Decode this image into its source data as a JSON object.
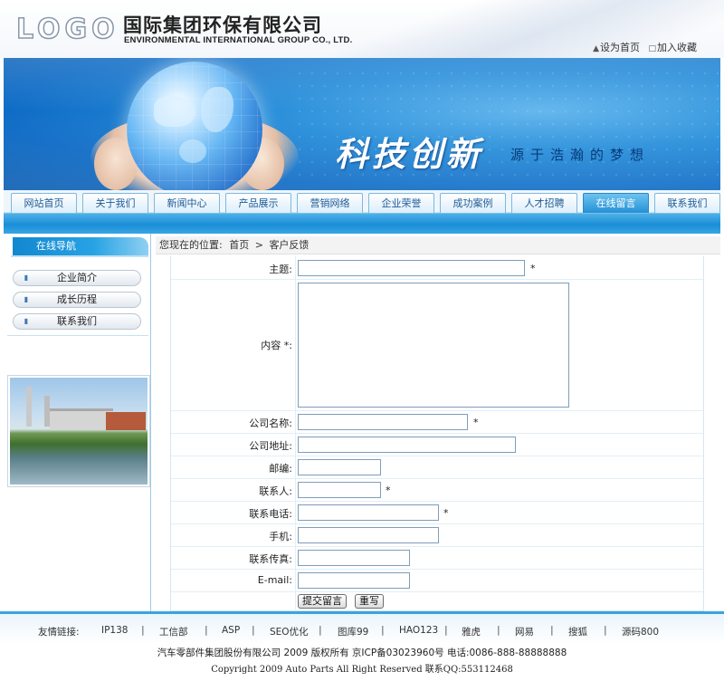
{
  "header": {
    "logo_text": "LOGO",
    "company_cn": "国际集团环保有限公司",
    "company_en": "ENVIRONMENTAL INTERNATIONAL GROUP CO., LTD.",
    "set_home_label": "设为首页",
    "add_favorite_label": "加入收藏"
  },
  "banner": {
    "slogan_main": "科技创新",
    "slogan_sub": "源于浩瀚的梦想"
  },
  "nav": {
    "items": [
      {
        "label": "网站首页"
      },
      {
        "label": "关于我们"
      },
      {
        "label": "新闻中心"
      },
      {
        "label": "产品展示"
      },
      {
        "label": "营销网络"
      },
      {
        "label": "企业荣誉"
      },
      {
        "label": "成功案例"
      },
      {
        "label": "人才招聘"
      },
      {
        "label": "在线留言"
      },
      {
        "label": "联系我们"
      }
    ],
    "active_index": 8
  },
  "sidebar": {
    "title": "在线导航",
    "items": [
      {
        "label": "企业简介"
      },
      {
        "label": "成长历程"
      },
      {
        "label": "联系我们"
      }
    ]
  },
  "breadcrumb": {
    "prefix": "您现在的位置:",
    "home": "首页",
    "separator": ">",
    "current": "客户反馈"
  },
  "form": {
    "required_mark": "*",
    "fields": {
      "subject": {
        "label": "主题:",
        "value": ""
      },
      "content": {
        "label": "内容 *:",
        "value": ""
      },
      "company": {
        "label": "公司名称:",
        "value": ""
      },
      "address": {
        "label": "公司地址:",
        "value": ""
      },
      "zip": {
        "label": "邮编:",
        "value": ""
      },
      "contact": {
        "label": "联系人:",
        "value": ""
      },
      "phone": {
        "label": "联系电话:",
        "value": ""
      },
      "mobile": {
        "label": "手机:",
        "value": ""
      },
      "fax": {
        "label": "联系传真:",
        "value": ""
      },
      "email": {
        "label": "E-mail:",
        "value": ""
      }
    },
    "submit_label": "提交留言",
    "reset_label": "重写"
  },
  "footer": {
    "friend_links_label": "友情链接:",
    "links": [
      {
        "label": "IP138"
      },
      {
        "label": "工信部"
      },
      {
        "label": "ASP"
      },
      {
        "label": "SEO优化"
      },
      {
        "label": "图库99"
      },
      {
        "label": "HAO123"
      },
      {
        "label": "雅虎"
      },
      {
        "label": "网易"
      },
      {
        "label": "搜狐"
      },
      {
        "label": "源码800"
      }
    ],
    "separator": "|",
    "copyright_cn": "汽车零部件集团股份有限公司 2009 版权所有 京ICP备03023960号 电话:0086-888-88888888",
    "copyright_en": "Copyright 2009 Auto Parts All Right Reserved  联系QQ:553112468"
  },
  "colors": {
    "accent": "#1a8ed8",
    "nav_active": "#2591d6",
    "sidebar_title": "#1287cf"
  }
}
